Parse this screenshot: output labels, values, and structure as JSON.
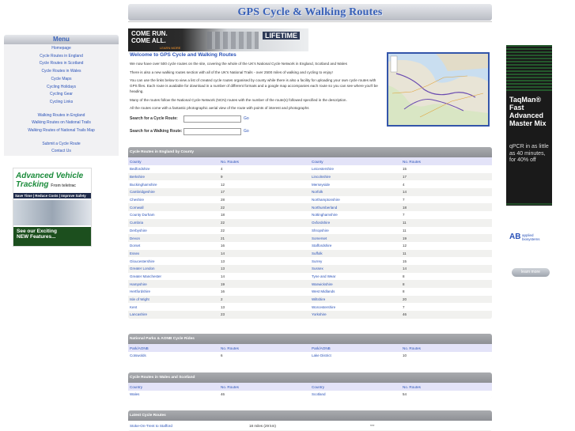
{
  "header": {
    "title": "GPS Cycle & Walking Routes"
  },
  "menu": {
    "title": "Menu",
    "group1": [
      "Homepage",
      "Cycle Routes in England",
      "Cycle Routes in Scotland",
      "Cycle Routes in Wales",
      "Cycle Maps",
      "Cycling Holidays",
      "Cycling Gear",
      "Cycling Links"
    ],
    "group2": [
      "Walking Routes in England",
      "Walking Routes on National Trails",
      "Walking Routes of National Trails Map"
    ],
    "group3": [
      "Submit a Cycle Route",
      "Contact Us"
    ]
  },
  "ad_left": {
    "line1": "Advanced Vehicle",
    "line2": "Tracking",
    "from": "From teletrac",
    "bar": "Save Time | Reduce Costs | Improve Safety",
    "cta1": "See our Exciting",
    "cta2": "NEW Features..."
  },
  "banner": {
    "line1": "COME RUN.",
    "line2": "COME ALL.",
    "cta": "LEARN MORE",
    "brand": "LIFETIME"
  },
  "intro": {
    "title": "Welcome to GPS Cycle and Walking Routes",
    "p1": "We now have over 500 cycle routes on the site, covering the whole of the UK's National Cycle Network in England, Scotland and Wales",
    "p2": "There is also a new walking routes section with all of the UK's National Trails - over 2500 miles of walking and cycling to enjoy!",
    "p3": "You can use the links below to view a list of created cycle routes organised by county while there is also a facility for uploading your own cycle routes with GPS files. Each route is available for download in a number of different formats and a google map accompanies each route so you can see where you'll be heading.",
    "p4": "Many of the routes follow the National Cycle Network (NCN) routes with the number of the route(s) followed specified in the description.",
    "p5": "All the routes come with a fantastic photographic aerial view of the route with points of interest and photographs",
    "search_cycle_label": "Search for a Cycle Route:",
    "search_walk_label": "Search for a Walking Route:",
    "go": "Go"
  },
  "ad_right": {
    "text": "TaqMan® Fast Advanced Master Mix",
    "sub": "qPCR in as little as 40 minutes, for 40% off",
    "brand": "applied biosystems",
    "learn": "learn more"
  },
  "england": {
    "title": "Cycle Routes in England by County",
    "headers": [
      "County",
      "No. Routes",
      "County",
      "No. Routes"
    ],
    "rows": [
      [
        "Bedfordshire",
        "4",
        "Leicestershire",
        "15"
      ],
      [
        "Berkshire",
        "9",
        "Lincolnshire",
        "17"
      ],
      [
        "Buckinghamshire",
        "12",
        "Merseyside",
        "4"
      ],
      [
        "Cambridgeshire",
        "17",
        "Norfolk",
        "14"
      ],
      [
        "Cheshire",
        "28",
        "Northamptonshire",
        "7"
      ],
      [
        "Cornwall",
        "22",
        "Northumberland",
        "18"
      ],
      [
        "County Durham",
        "18",
        "Nottinghamshire",
        "7"
      ],
      [
        "Cumbria",
        "22",
        "Oxfordshire",
        "11"
      ],
      [
        "Derbyshire",
        "22",
        "Shropshire",
        "11"
      ],
      [
        "Devon",
        "21",
        "Somerset",
        "19"
      ],
      [
        "Dorset",
        "16",
        "Staffordshire",
        "12"
      ],
      [
        "Essex",
        "14",
        "Suffolk",
        "11"
      ],
      [
        "Gloucestershire",
        "13",
        "Surrey",
        "15"
      ],
      [
        "Greater London",
        "13",
        "Sussex",
        "14"
      ],
      [
        "Greater Manchester",
        "14",
        "Tyne and Wear",
        "8"
      ],
      [
        "Hampshire",
        "19",
        "Warwickshire",
        "8"
      ],
      [
        "Hertfordshire",
        "16",
        "West Midlands",
        "8"
      ],
      [
        "Isle of Wight",
        "2",
        "Wiltshire",
        "20"
      ],
      [
        "Kent",
        "13",
        "Worcestershire",
        "7"
      ],
      [
        "Lancashire",
        "23",
        "Yorkshire",
        "46"
      ]
    ]
  },
  "parks": {
    "title": "National Parks & AONB Cycle Rides",
    "headers": [
      "Park/AONB",
      "No. Routes",
      "Park/AONB",
      "No. Routes"
    ],
    "rows": [
      [
        "Cotswolds",
        "6",
        "Lake District",
        "10"
      ]
    ]
  },
  "wales": {
    "title": "Cycle Routes in Wales and Scotland",
    "headers": [
      "Country",
      "No. Routes",
      "Country",
      "No. Routes"
    ],
    "rows": [
      [
        "Wales",
        "46",
        "Scotland",
        "54"
      ]
    ]
  },
  "latest": {
    "title": "Latest Cycle Routes",
    "route": "Stoke-On-Trent to Stafford",
    "distance": "18 miles (29 km)",
    "extra": "***"
  }
}
